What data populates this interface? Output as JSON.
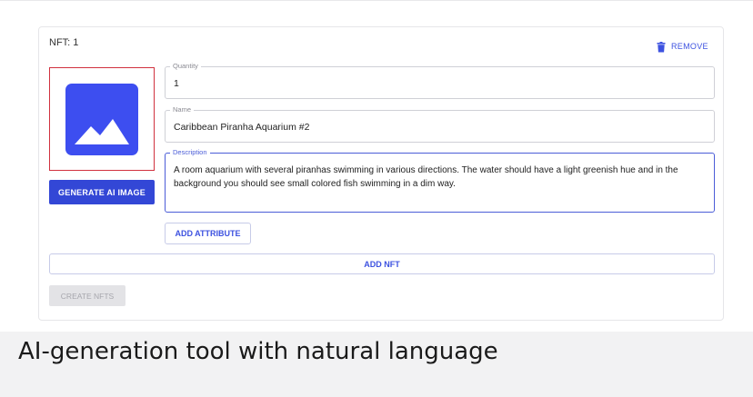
{
  "nft": {
    "title": "NFT: 1",
    "remove_label": "REMOVE",
    "generate_label": "GENERATE AI IMAGE",
    "fields": {
      "quantity": {
        "label": "Quantity",
        "value": "1"
      },
      "name": {
        "label": "Name",
        "value": "Caribbean Piranha Aquarium #2"
      },
      "description": {
        "label": "Description",
        "value": "A room aquarium with several piranhas swimming in various directions. The water should have a light greenish hue and in the background you should see small colored fish swimming in a dim way."
      }
    },
    "add_attribute_label": "ADD ATTRIBUTE"
  },
  "actions": {
    "add_nft_label": "ADD NFT",
    "create_nfts_label": "CREATE NFTS"
  },
  "caption": "AI-generation tool with natural language",
  "icons": {
    "remove": "trash-icon",
    "placeholder": "image-placeholder-icon"
  },
  "colors": {
    "accent": "#3d52e0",
    "image_icon": "#3d4ef0",
    "selected_border": "#d1313f",
    "disabled": "#e3e3e6"
  }
}
